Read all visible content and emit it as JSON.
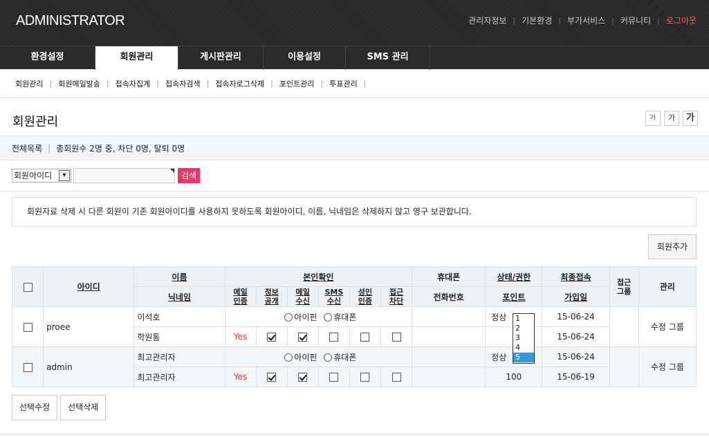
{
  "header": {
    "logo": "ADMINISTRATOR",
    "links": [
      "관리자정보",
      "기본환경",
      "부가서비스",
      "커뮤니티"
    ],
    "logout": "로그아웃"
  },
  "gnb": [
    "환경설정",
    "회원관리",
    "게시판관리",
    "이용설정",
    "SMS 관리"
  ],
  "snb": [
    "회원관리",
    "회원메일발송",
    "접속자집계",
    "접속자검색",
    "접속자로그삭제",
    "포인트관리",
    "투표관리"
  ],
  "page_title": "회원관리",
  "font_buttons": [
    "가",
    "가",
    "가"
  ],
  "summary": {
    "label": "전체목록",
    "text": "총회원수 2명 중, 차단 0명, 탈퇴 0명"
  },
  "search": {
    "select_value": "회원아이디",
    "button": "검색"
  },
  "notice": "회원자료 삭제 시 다른 회원이 기존 회원아이디를 사용하지 못하도록 회원아이디, 이름, 닉네임은 삭제하지 않고 영구 보관합니다.",
  "add_button": "회원추가",
  "table": {
    "headers": {
      "id": "아이디",
      "name": "이름",
      "nick": "닉네임",
      "verify": "본인확인",
      "mail1": "메일",
      "mail2": "인증",
      "info1": "정보",
      "info2": "공개",
      "recv1": "메일",
      "recv2": "수신",
      "sms1": "SMS",
      "sms2": "수신",
      "adult1": "성인",
      "adult2": "인증",
      "block1": "접근",
      "block2": "차단",
      "mobile": "휴대폰",
      "phone": "전화번호",
      "status": "상태/권한",
      "point": "포인트",
      "last": "최종접속",
      "join": "가입일",
      "group1": "접근",
      "group2": "그룹",
      "manage": "관리"
    },
    "rows": [
      {
        "id": "proee",
        "name": "이석호",
        "nick": "학원통",
        "radio1": "아이핀",
        "radio2": "휴대폰",
        "mail_cert": "Yes",
        "status": "정상",
        "last": "15-06-24",
        "join": "15-06-24",
        "manage": "수정 그룹"
      },
      {
        "id": "admin",
        "name": "최고관리자",
        "nick": "최고관리자",
        "radio1": "아이핀",
        "radio2": "휴대폰",
        "mail_cert": "Yes",
        "status": "정상",
        "point": "100",
        "last": "15-06-24",
        "join": "15-06-19",
        "manage": "수정 그룹"
      }
    ],
    "level_options": [
      "1",
      "2",
      "3",
      "4",
      "5"
    ]
  },
  "bottom_buttons": [
    "선택수정",
    "선택삭제"
  ]
}
